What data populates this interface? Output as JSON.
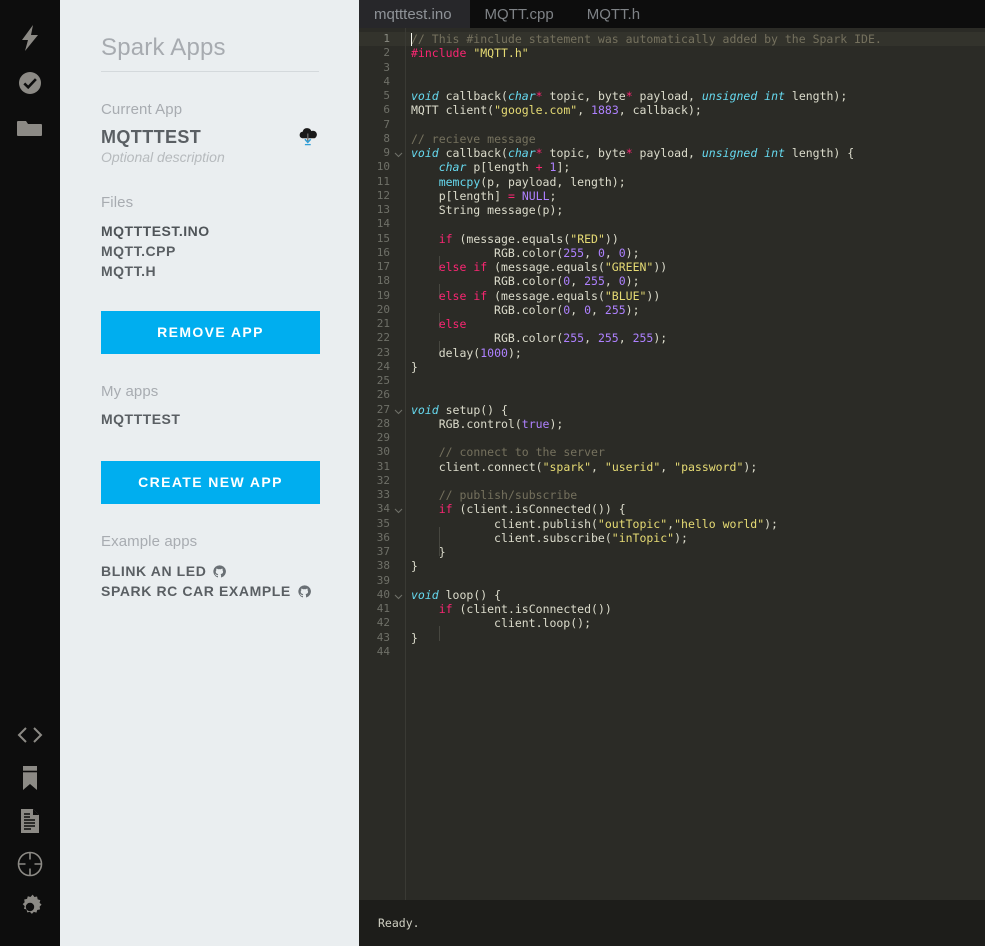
{
  "colors": {
    "accent": "#00aeef",
    "rail_bg": "#0d0d0d",
    "panel_bg": "#eaeef0",
    "editor_bg": "#2b2b26",
    "tabbar_bg": "#0d0d0d",
    "statusbar_bg": "#1d1d1a"
  },
  "rail": {
    "top_items": [
      {
        "name": "flash-icon",
        "label": "Flash"
      },
      {
        "name": "verify-icon",
        "label": "Verify"
      },
      {
        "name": "code-folder-icon",
        "label": "Apps"
      }
    ],
    "bottom_items": [
      {
        "name": "code-brackets-icon",
        "label": "Code"
      },
      {
        "name": "bookmark-icon",
        "label": "Libraries"
      },
      {
        "name": "document-icon",
        "label": "Docs"
      },
      {
        "name": "target-icon",
        "label": "Cores"
      },
      {
        "name": "gear-icon",
        "label": "Settings"
      }
    ]
  },
  "panel": {
    "title": "Spark Apps",
    "current_app": {
      "label": "Current App",
      "name": "MQTTTEST",
      "description": "Optional description",
      "flash_icon": "cloud-download-icon"
    },
    "files": {
      "label": "Files",
      "items": [
        {
          "name": "MQTTTEST.INO",
          "active": true
        },
        {
          "name": "MQTT.CPP",
          "active": false
        },
        {
          "name": "MQTT.H",
          "active": false
        }
      ]
    },
    "remove_app_button": "REMOVE APP",
    "my_apps": {
      "label": "My apps",
      "items": [
        "MQTTTEST"
      ]
    },
    "create_new_app_button": "CREATE NEW APP",
    "example_apps": {
      "label": "Example apps",
      "items": [
        {
          "name": "BLINK AN LED",
          "icon": "github-icon"
        },
        {
          "name": "SPARK RC CAR EXAMPLE",
          "icon": "github-icon"
        }
      ]
    }
  },
  "editor": {
    "tabs": [
      {
        "label": "mqtttest.ino",
        "active": true
      },
      {
        "label": "MQTT.cpp",
        "active": false
      },
      {
        "label": "MQTT.h",
        "active": false
      }
    ],
    "cursor_line": 1,
    "cursor_col": 1,
    "total_lines": 44,
    "fold_lines": [
      9,
      27,
      34,
      40
    ],
    "line_numbers_from": 1,
    "line_numbers_to": 44,
    "code_lines": [
      "// This #include statement was automatically added by the Spark IDE.",
      "#include \"MQTT.h\"",
      "",
      "",
      "void callback(char* topic, byte* payload, unsigned int length);",
      "MQTT client(\"google.com\", 1883, callback);",
      "",
      "// recieve message",
      "void callback(char* topic, byte* payload, unsigned int length) {",
      "    char p[length + 1];",
      "    memcpy(p, payload, length);",
      "    p[length] = NULL;",
      "    String message(p);",
      "",
      "    if (message.equals(\"RED\"))",
      "        RGB.color(255, 0, 0);",
      "    else if (message.equals(\"GREEN\"))",
      "        RGB.color(0, 255, 0);",
      "    else if (message.equals(\"BLUE\"))",
      "        RGB.color(0, 0, 255);",
      "    else",
      "        RGB.color(255, 255, 255);",
      "    delay(1000);",
      "}",
      "",
      "",
      "void setup() {",
      "    RGB.control(true);",
      "",
      "    // connect to the server",
      "    client.connect(\"spark\", \"userid\", \"password\");",
      "",
      "    // publish/subscribe",
      "    if (client.isConnected()) {",
      "        client.publish(\"outTopic\",\"hello world\");",
      "        client.subscribe(\"inTopic\");",
      "    }",
      "}",
      "",
      "void loop() {",
      "    if (client.isConnected())",
      "        client.loop();",
      "}",
      ""
    ],
    "code_tokens": [
      [
        [
          "// This #include statement was automatically added by the Spark IDE.",
          "c-com"
        ]
      ],
      [
        [
          "#include ",
          "c-pre"
        ],
        [
          "\"MQTT.h\"",
          "c-str"
        ]
      ],
      [],
      [],
      [
        [
          "void",
          "c-type"
        ],
        [
          " callback(",
          "c-pln"
        ],
        [
          "char",
          "c-type"
        ],
        [
          "*",
          "c-op"
        ],
        [
          " topic, byte",
          "c-pln"
        ],
        [
          "*",
          "c-op"
        ],
        [
          " payload, ",
          "c-pln"
        ],
        [
          "unsigned int",
          "c-type"
        ],
        [
          " length);",
          "c-pln"
        ]
      ],
      [
        [
          "MQTT client(",
          "c-pln"
        ],
        [
          "\"google.com\"",
          "c-str"
        ],
        [
          ", ",
          "c-pln"
        ],
        [
          "1883",
          "c-num"
        ],
        [
          ", callback);",
          "c-pln"
        ]
      ],
      [],
      [
        [
          "// recieve message",
          "c-com"
        ]
      ],
      [
        [
          "void",
          "c-type"
        ],
        [
          " callback(",
          "c-pln"
        ],
        [
          "char",
          "c-type"
        ],
        [
          "*",
          "c-op"
        ],
        [
          " topic, byte",
          "c-pln"
        ],
        [
          "*",
          "c-op"
        ],
        [
          " payload, ",
          "c-pln"
        ],
        [
          "unsigned int",
          "c-type"
        ],
        [
          " length) {",
          "c-pln"
        ]
      ],
      [
        [
          "    ",
          "c-pln"
        ],
        [
          "char",
          "c-type"
        ],
        [
          " p[length ",
          "c-pln"
        ],
        [
          "+",
          "c-op"
        ],
        [
          " ",
          "c-pln"
        ],
        [
          "1",
          "c-num"
        ],
        [
          "];",
          "c-pln"
        ]
      ],
      [
        [
          "    ",
          "c-pln"
        ],
        [
          "memcpy",
          "c-fn"
        ],
        [
          "(p, payload, length);",
          "c-pln"
        ]
      ],
      [
        [
          "    p[length] ",
          "c-pln"
        ],
        [
          "=",
          "c-op"
        ],
        [
          " ",
          "c-pln"
        ],
        [
          "NULL",
          "c-cst"
        ],
        [
          ";",
          "c-pln"
        ]
      ],
      [
        [
          "    String message(p);",
          "c-pln"
        ]
      ],
      [],
      [
        [
          "    ",
          "c-pln"
        ],
        [
          "if",
          "c-kw"
        ],
        [
          " (message.equals(",
          "c-pln"
        ],
        [
          "\"RED\"",
          "c-str"
        ],
        [
          "))",
          "c-pln"
        ]
      ],
      [
        [
          "        RGB.color(",
          "c-pln"
        ],
        [
          "255",
          "c-num"
        ],
        [
          ", ",
          "c-pln"
        ],
        [
          "0",
          "c-num"
        ],
        [
          ", ",
          "c-pln"
        ],
        [
          "0",
          "c-num"
        ],
        [
          ");",
          "c-pln"
        ]
      ],
      [
        [
          "    ",
          "c-pln"
        ],
        [
          "else if",
          "c-kw"
        ],
        [
          " (message.equals(",
          "c-pln"
        ],
        [
          "\"GREEN\"",
          "c-str"
        ],
        [
          "))",
          "c-pln"
        ]
      ],
      [
        [
          "        RGB.color(",
          "c-pln"
        ],
        [
          "0",
          "c-num"
        ],
        [
          ", ",
          "c-pln"
        ],
        [
          "255",
          "c-num"
        ],
        [
          ", ",
          "c-pln"
        ],
        [
          "0",
          "c-num"
        ],
        [
          ");",
          "c-pln"
        ]
      ],
      [
        [
          "    ",
          "c-pln"
        ],
        [
          "else if",
          "c-kw"
        ],
        [
          " (message.equals(",
          "c-pln"
        ],
        [
          "\"BLUE\"",
          "c-str"
        ],
        [
          "))",
          "c-pln"
        ]
      ],
      [
        [
          "        RGB.color(",
          "c-pln"
        ],
        [
          "0",
          "c-num"
        ],
        [
          ", ",
          "c-pln"
        ],
        [
          "0",
          "c-num"
        ],
        [
          ", ",
          "c-pln"
        ],
        [
          "255",
          "c-num"
        ],
        [
          ");",
          "c-pln"
        ]
      ],
      [
        [
          "    ",
          "c-pln"
        ],
        [
          "else",
          "c-kw"
        ]
      ],
      [
        [
          "        RGB.color(",
          "c-pln"
        ],
        [
          "255",
          "c-num"
        ],
        [
          ", ",
          "c-pln"
        ],
        [
          "255",
          "c-num"
        ],
        [
          ", ",
          "c-pln"
        ],
        [
          "255",
          "c-num"
        ],
        [
          ");",
          "c-pln"
        ]
      ],
      [
        [
          "    delay(",
          "c-pln"
        ],
        [
          "1000",
          "c-num"
        ],
        [
          ");",
          "c-pln"
        ]
      ],
      [
        [
          "}",
          "c-pln"
        ]
      ],
      [],
      [],
      [
        [
          "void",
          "c-type"
        ],
        [
          " setup() {",
          "c-pln"
        ]
      ],
      [
        [
          "    RGB.control(",
          "c-pln"
        ],
        [
          "true",
          "c-cst"
        ],
        [
          ");",
          "c-pln"
        ]
      ],
      [],
      [
        [
          "    ",
          "c-pln"
        ],
        [
          "// connect to the server",
          "c-com"
        ]
      ],
      [
        [
          "    client.connect(",
          "c-pln"
        ],
        [
          "\"spark\"",
          "c-str"
        ],
        [
          ", ",
          "c-pln"
        ],
        [
          "\"userid\"",
          "c-str"
        ],
        [
          ", ",
          "c-pln"
        ],
        [
          "\"password\"",
          "c-str"
        ],
        [
          ");",
          "c-pln"
        ]
      ],
      [],
      [
        [
          "    ",
          "c-pln"
        ],
        [
          "// publish/subscribe",
          "c-com"
        ]
      ],
      [
        [
          "    ",
          "c-pln"
        ],
        [
          "if",
          "c-kw"
        ],
        [
          " (client.isConnected()) {",
          "c-pln"
        ]
      ],
      [
        [
          "        client.publish(",
          "c-pln"
        ],
        [
          "\"outTopic\"",
          "c-str"
        ],
        [
          ",",
          "c-pln"
        ],
        [
          "\"hello world\"",
          "c-str"
        ],
        [
          ");",
          "c-pln"
        ]
      ],
      [
        [
          "        client.subscribe(",
          "c-pln"
        ],
        [
          "\"inTopic\"",
          "c-str"
        ],
        [
          ");",
          "c-pln"
        ]
      ],
      [
        [
          "    }",
          "c-pln"
        ]
      ],
      [
        [
          "}",
          "c-pln"
        ]
      ],
      [],
      [
        [
          "void",
          "c-type"
        ],
        [
          " loop() {",
          "c-pln"
        ]
      ],
      [
        [
          "    ",
          "c-pln"
        ],
        [
          "if",
          "c-kw"
        ],
        [
          " (client.isConnected())",
          "c-pln"
        ]
      ],
      [
        [
          "        client.loop();",
          "c-pln"
        ]
      ],
      [
        [
          "}",
          "c-pln"
        ]
      ],
      []
    ],
    "indent_guides": [
      [],
      [],
      [],
      [],
      [],
      [],
      [],
      [],
      [],
      [],
      [],
      [],
      [],
      [],
      [],
      [
        1
      ],
      [],
      [
        1
      ],
      [],
      [
        1
      ],
      [],
      [
        1
      ],
      [],
      [],
      [],
      [],
      [],
      [],
      [],
      [],
      [],
      [],
      [],
      [],
      [
        1
      ],
      [
        1
      ],
      [],
      [],
      [],
      [],
      [],
      [
        1
      ],
      [],
      []
    ],
    "status": "Ready."
  }
}
